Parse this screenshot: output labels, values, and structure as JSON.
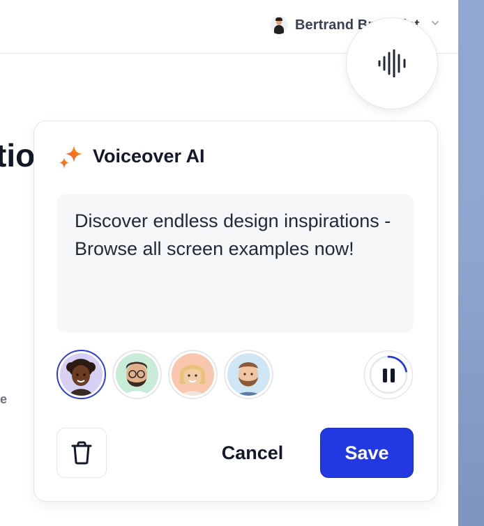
{
  "header": {
    "user_name": "Bertrand Bruandet"
  },
  "background": {
    "heading_fragment": "tio",
    "text_fragment": "e"
  },
  "voiceover_card": {
    "title": "Voiceover AI",
    "text": "Discover endless design inspirations - Browse all screen examples now!",
    "voices": [
      {
        "name": "voice-1",
        "selected": true
      },
      {
        "name": "voice-2",
        "selected": false
      },
      {
        "name": "voice-3",
        "selected": false
      },
      {
        "name": "voice-4",
        "selected": false
      }
    ],
    "playback_state": "playing",
    "cancel_label": "Cancel",
    "save_label": "Save"
  },
  "colors": {
    "accent": "#2238e0",
    "selected_ring": "#2f3fd6",
    "sparkle_gradient": [
      "#f59e0b",
      "#ec4899"
    ]
  },
  "icons": {
    "fab": "waveform-icon",
    "title": "sparkle-icon",
    "pause": "pause-icon",
    "delete": "trash-icon",
    "user_menu": "chevron-down-icon"
  }
}
